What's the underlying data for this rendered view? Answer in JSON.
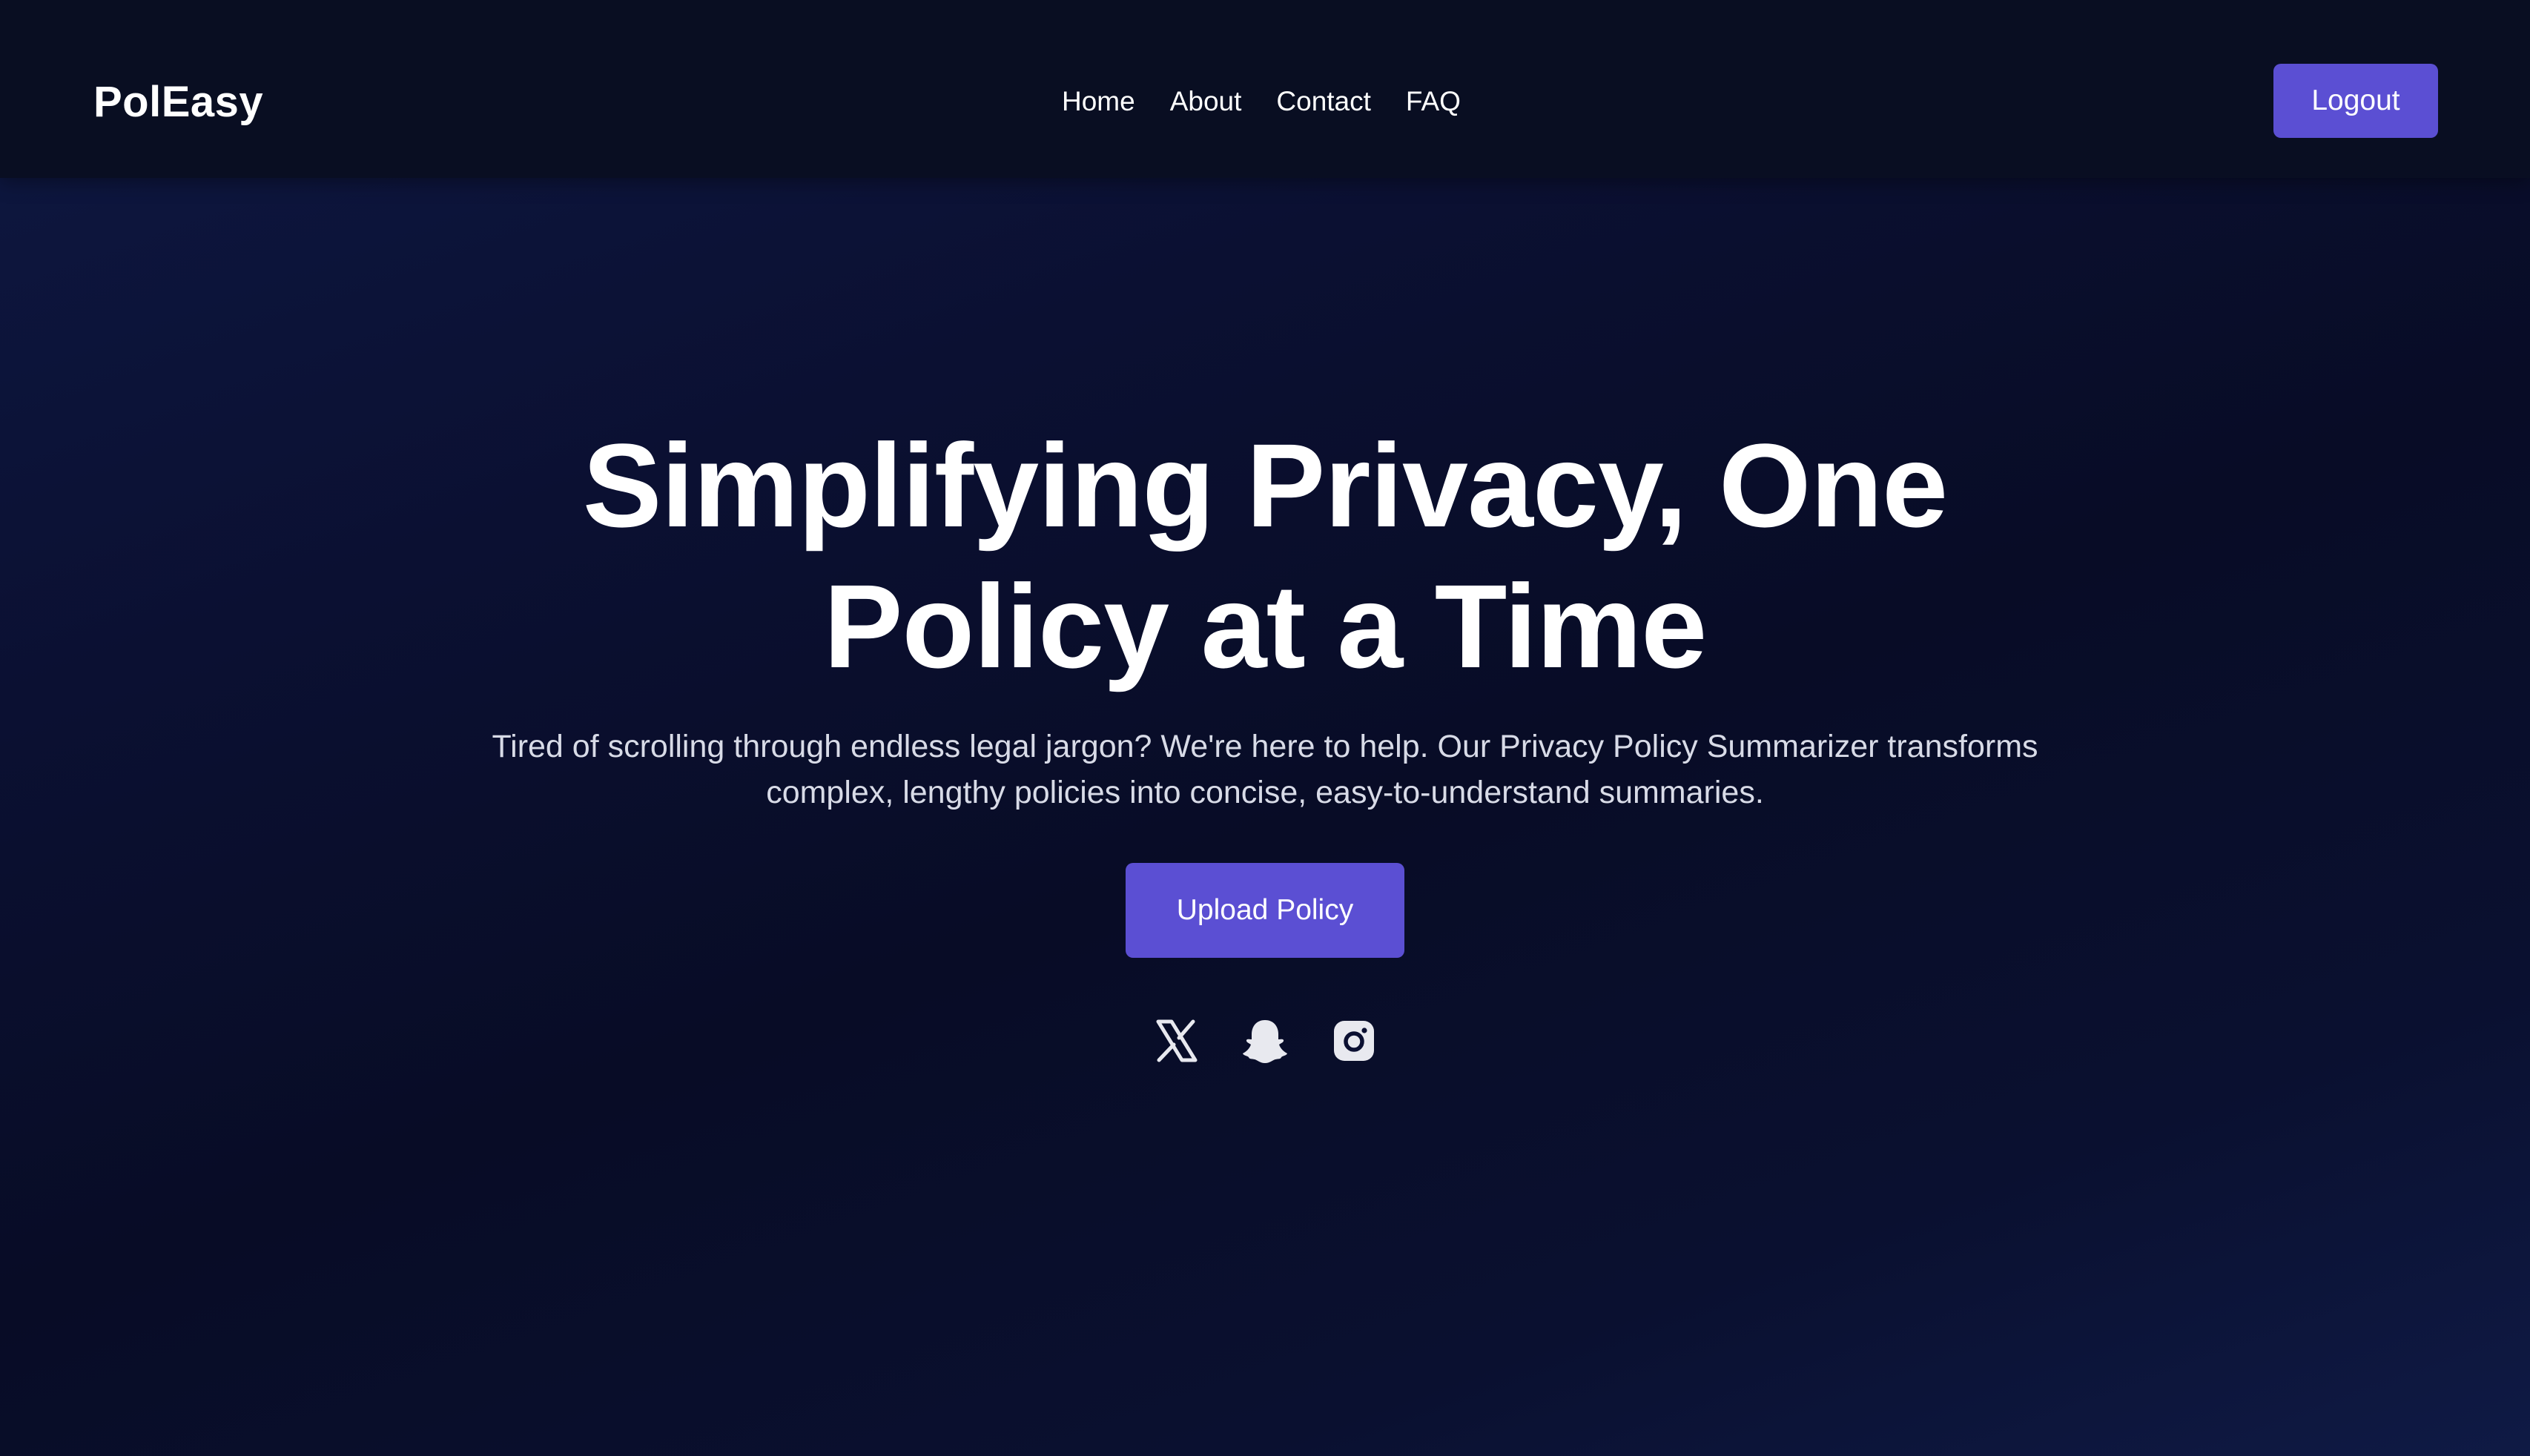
{
  "header": {
    "brand": "PolEasy",
    "nav": [
      {
        "label": "Home"
      },
      {
        "label": "About"
      },
      {
        "label": "Contact"
      },
      {
        "label": "FAQ"
      }
    ],
    "logout_label": "Logout"
  },
  "hero": {
    "title": "Simplifying Privacy, One Policy at a Time",
    "description": "Tired of scrolling through endless legal jargon? We're here to help. Our Privacy Policy Summarizer transforms complex, lengthy policies into concise, easy-to-understand summaries.",
    "upload_label": "Upload Policy"
  },
  "socials": [
    {
      "icon": "x-twitter-icon"
    },
    {
      "icon": "snapchat-icon"
    },
    {
      "icon": "instagram-icon"
    }
  ],
  "colors": {
    "accent": "#5b4fd3",
    "navbar": "#090e22",
    "background": "#0b1032",
    "text": "#ffffff",
    "muted_text": "#d8dbe7"
  }
}
